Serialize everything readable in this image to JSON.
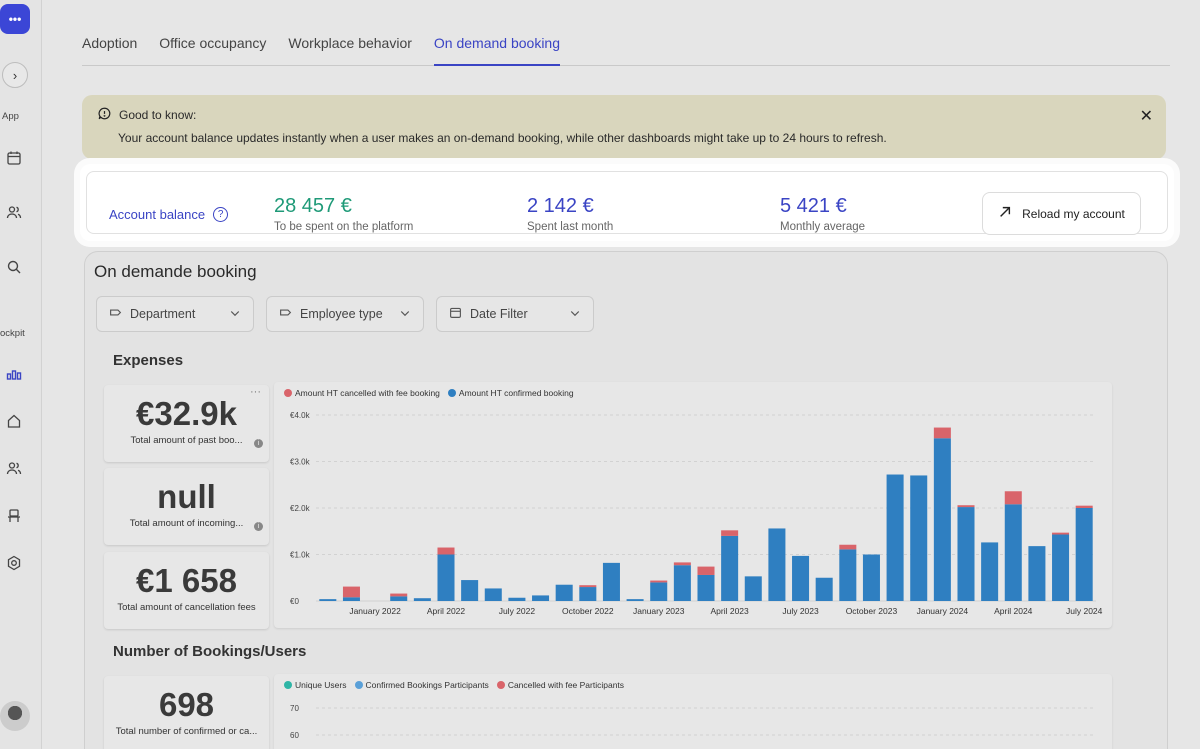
{
  "sidebar": {
    "logo": "•••",
    "labels": {
      "app": "App",
      "cockpit": "ockpit"
    }
  },
  "tabs": [
    {
      "label": "Adoption"
    },
    {
      "label": "Office occupancy"
    },
    {
      "label": "Workplace behavior"
    },
    {
      "label": "On demand booking",
      "active": true
    }
  ],
  "notice": {
    "title": "Good to know:",
    "text": "Your account balance updates instantly when a user makes an on-demand booking, while other dashboards might take up to 24 hours to refresh."
  },
  "balance": {
    "label": "Account balance",
    "stats": [
      {
        "value": "28 457 €",
        "sub": "To be spent on the platform",
        "color": "#1f9a78"
      },
      {
        "value": "2 142 €",
        "sub": "Spent last month",
        "color": "#3a44c4"
      },
      {
        "value": "5 421 €",
        "sub": "Monthly average",
        "color": "#3a44c4"
      }
    ],
    "reload_label": "Reload my account"
  },
  "panel": {
    "title": "On demande booking",
    "filters": [
      {
        "label": "Department"
      },
      {
        "label": "Employee type"
      },
      {
        "label": "Date Filter"
      }
    ],
    "expenses_title": "Expenses",
    "bookings_title": "Number of Bookings/Users",
    "kpis": [
      {
        "value": "€32.9k",
        "label": "Total amount of past boo..."
      },
      {
        "value": "null",
        "label": "Total amount of incoming..."
      },
      {
        "value": "€1 658",
        "label": "Total amount of cancellation fees"
      }
    ],
    "kpi_bookings": {
      "value": "698",
      "label": "Total number of confirmed or ca..."
    }
  },
  "colors": {
    "confirmed": "#2f7fc1",
    "cancelled": "#d9646a",
    "unique": "#2fb5a6",
    "participants": "#5aa0d8"
  },
  "chart_data": [
    {
      "type": "bar",
      "stacked": true,
      "legend": [
        "Amount HT cancelled with fee booking",
        "Amount HT confirmed booking"
      ],
      "y_ticks": [
        "€0",
        "€1.0k",
        "€2.0k",
        "€3.0k",
        "€4.0k"
      ],
      "ylim": [
        0,
        4000
      ],
      "x_tick_labels": [
        "January 2022",
        "April 2022",
        "July 2022",
        "October 2022",
        "January 2023",
        "April 2023",
        "July 2023",
        "October 2023",
        "January 2024",
        "April 2024",
        "July 2024"
      ],
      "x_tick_index": [
        2,
        5,
        8,
        11,
        14,
        17,
        20,
        23,
        26,
        29,
        32
      ],
      "series": [
        {
          "name": "Amount HT confirmed booking",
          "values": [
            40,
            80,
            0,
            100,
            60,
            1000,
            450,
            270,
            70,
            120,
            350,
            300,
            820,
            40,
            400,
            770,
            560,
            1400,
            530,
            1560,
            970,
            500,
            1110,
            1000,
            2720,
            2700,
            3500,
            2020,
            1260,
            2080,
            1180,
            1430,
            2000
          ]
        },
        {
          "name": "Amount HT cancelled with fee booking",
          "values": [
            0,
            230,
            0,
            60,
            0,
            150,
            0,
            0,
            0,
            0,
            0,
            40,
            0,
            0,
            40,
            60,
            180,
            120,
            0,
            0,
            0,
            0,
            100,
            0,
            0,
            0,
            230,
            40,
            0,
            280,
            0,
            40,
            50
          ]
        }
      ]
    },
    {
      "type": "bar",
      "legend": [
        "Unique Users",
        "Confirmed Bookings Participants",
        "Cancelled with fee Participants"
      ],
      "y_ticks": [
        "60",
        "70"
      ]
    }
  ]
}
